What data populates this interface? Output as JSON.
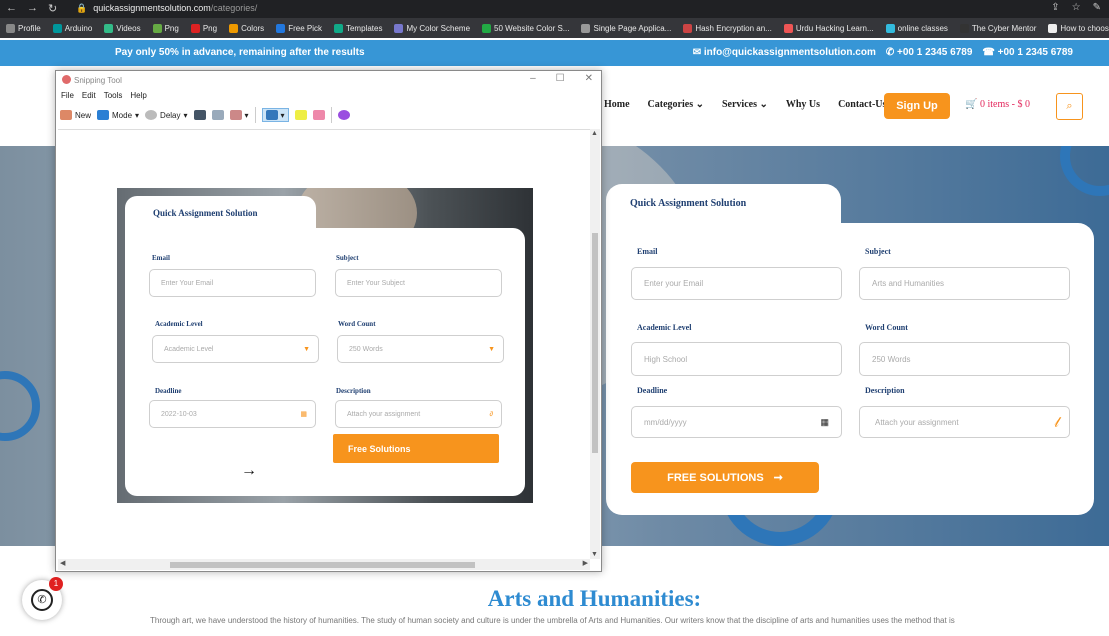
{
  "browser": {
    "url_host": "quickassignmentsolution.com",
    "url_path": "/categories/",
    "bookmarks": [
      {
        "label": "Profile",
        "color": "#888"
      },
      {
        "label": "Arduino",
        "color": "#00979c"
      },
      {
        "label": "Videos",
        "color": "#3b8"
      },
      {
        "label": "Png",
        "color": "#6a4"
      },
      {
        "label": "Png",
        "color": "#d22"
      },
      {
        "label": "Colors",
        "color": "#e90"
      },
      {
        "label": "Free Pick",
        "color": "#27d"
      },
      {
        "label": "Templates",
        "color": "#1a8"
      },
      {
        "label": "My Color Scheme",
        "color": "#77c"
      },
      {
        "label": "50 Website Color S...",
        "color": "#2a4"
      },
      {
        "label": "Single Page Applica...",
        "color": "#999"
      },
      {
        "label": "Hash Encryption an...",
        "color": "#c44"
      },
      {
        "label": "Urdu Hacking Learn...",
        "color": "#e55"
      },
      {
        "label": "online classes",
        "color": "#3bd"
      },
      {
        "label": "The Cyber Mentor",
        "color": "#333"
      },
      {
        "label": "How to choose the...",
        "color": "#eee"
      }
    ]
  },
  "promo": {
    "text": "Pay only 50% in advance, remaining after the results",
    "email": "info@quickassignmentsolution.com",
    "phone1": "+00 1 2345 6789",
    "phone2": "+00 1 2345 6789"
  },
  "nav": {
    "home": "Home",
    "categories": "Categories",
    "services": "Services",
    "why_us": "Why Us",
    "contact": "Contact-Us",
    "signup": "Sign Up",
    "cart": "0 items - $ 0"
  },
  "form": {
    "title": "Quick Assignment Solution",
    "email_label": "Email",
    "email_placeholder": "Enter your Email",
    "subject_label": "Subject",
    "subject_placeholder": "Arts and Humanities",
    "academic_label": "Academic Level",
    "academic_placeholder": "High School",
    "wordcount_label": "Word Count",
    "wordcount_placeholder": "250 Words",
    "deadline_label": "Deadline",
    "deadline_placeholder": "mm/dd/yyyy",
    "description_label": "Description",
    "description_placeholder": "Attach your assignment",
    "submit": "FREE SOLUTIONS"
  },
  "section": {
    "heading": "Arts and Humanities:",
    "paragraph": "Through art, we have understood the history of humanities. The study of human society and culture is under the umbrella of Arts and Humanities. Our writers know that the discipline of arts and humanities uses the method that is"
  },
  "whatsapp": {
    "badge": "1"
  },
  "snipping_tool": {
    "title": "Snipping Tool",
    "menu": [
      "File",
      "Edit",
      "Tools",
      "Help"
    ],
    "new": "New",
    "mode": "Mode",
    "delay": "Delay",
    "capture": {
      "title": "Quick Assignment Solution",
      "email_label": "Email",
      "email_placeholder": "Enter Your Email",
      "subject_label": "Subject",
      "subject_placeholder": "Enter Your Subject",
      "academic_label": "Academic Level",
      "academic_placeholder": "Academic Level",
      "wordcount_label": "Word Count",
      "wordcount_placeholder": "250 Words",
      "deadline_label": "Deadline",
      "deadline_value": "2022-10-03",
      "description_label": "Description",
      "description_placeholder": "Attach your assignment",
      "submit": "Free Solutions"
    }
  },
  "colors": {
    "accent": "#f7941d",
    "brand_blue": "#3796d6",
    "title_navy": "#1f3f71"
  }
}
